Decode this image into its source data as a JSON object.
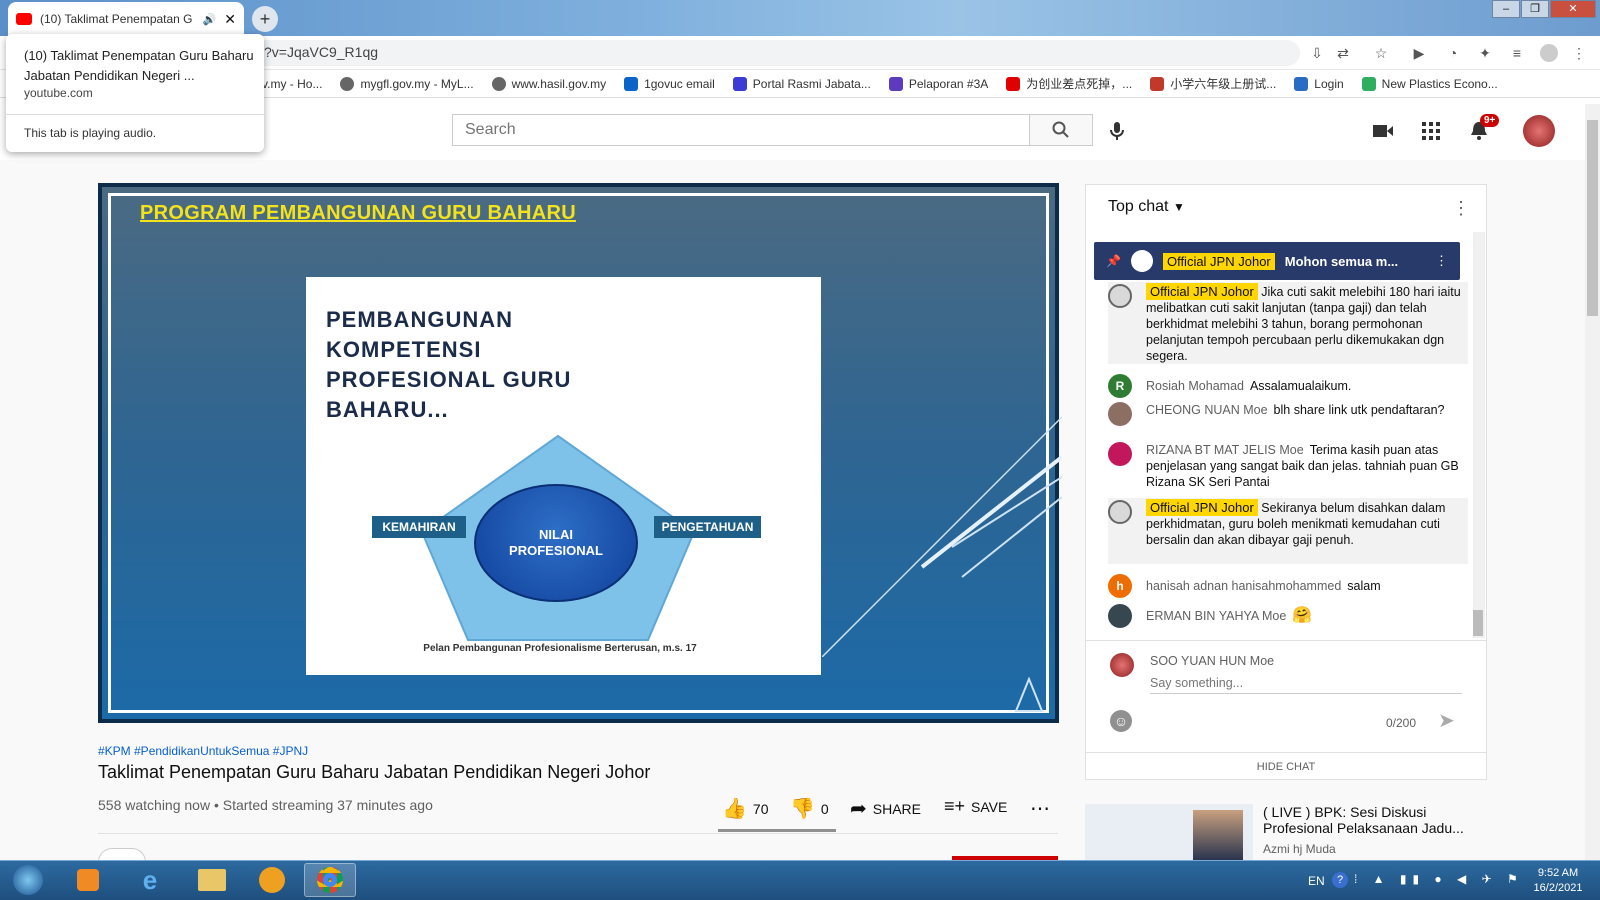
{
  "browser": {
    "tab_title": "(10) Taklimat Penempatan G",
    "url": "?v=JqaVC9_R1qg",
    "tooltip": {
      "title": "(10) Taklimat Penempatan Guru Baharu Jabatan Pendidikan Negeri ...",
      "domain": "youtube.com",
      "audio": "This tab is playing audio."
    },
    "bookmarks": [
      {
        "label": "v.my - Ho...",
        "color": "#888888"
      },
      {
        "label": "mygfl.gov.my - MyL...",
        "color": "#666666"
      },
      {
        "label": "www.hasil.gov.my",
        "color": "#666666"
      },
      {
        "label": "1govuc email",
        "color": "#0a64c8"
      },
      {
        "label": "Portal Rasmi Jabata...",
        "color": "#3b3bd6"
      },
      {
        "label": "Pelaporan #3A",
        "color": "#5c3bbf"
      },
      {
        "label": "为创业差点死掉，...",
        "color": "#e00000"
      },
      {
        "label": "小学六年级上册试...",
        "color": "#c0392b"
      },
      {
        "label": "Login",
        "color": "#2a6cc4"
      },
      {
        "label": "New Plastics Econo...",
        "color": "#2eae5e"
      }
    ]
  },
  "youtube": {
    "search_placeholder": "Search",
    "notif_count": "9+",
    "video": {
      "slide_title": "PROGRAM PEMBANGUNAN GURU BAHARU",
      "slide_heading": "PEMBANGUNAN KOMPETENSI PROFESIONAL GURU BAHARU...",
      "center": "NILAI PROFESIONAL",
      "left_box": "KEMAHIRAN",
      "right_box": "PENGETAHUAN",
      "caption": "Pelan Pembangunan Profesionalisme Berterusan, m.s. 17"
    },
    "tags": "#KPM #PendidikanUntukSemua #JPNJ",
    "title": "Taklimat Penempatan Guru Baharu Jabatan Pendidikan Negeri Johor",
    "views": "558 watching now • Started streaming 37 minutes ago",
    "likes": "70",
    "dislikes": "0",
    "share": "SHARE",
    "save": "SAVE"
  },
  "chat": {
    "header": "Top chat",
    "pinned_badge": "Official JPN Johor",
    "pinned_text": "Mohon semua m...",
    "messages": [
      {
        "author": "Official JPN Johor",
        "badge": true,
        "text": "Jika cuti sakit melebihi 180 hari iaitu melibatkan cuti sakit lanjutan (tanpa gaji) dan telah berkhidmat melebihi 3 tahun, borang permohonan pelanjutan tempoh percubaan perlu dikemukakan dgn segera.",
        "avatar": "#d9d9d9",
        "initial": ""
      },
      {
        "author": "Rosiah Mohamad",
        "badge": false,
        "text": "Assalamualaikum.",
        "avatar": "#2e7d32",
        "initial": "R"
      },
      {
        "author": "CHEONG NUAN Moe",
        "badge": false,
        "text": "blh share link utk pendaftaran?",
        "avatar": "#8d6e63",
        "initial": ""
      },
      {
        "author": "RIZANA BT MAT JELIS Moe",
        "badge": false,
        "text": "Terima kasih puan atas penjelasan yang sangat baik dan jelas. tahniah puan GB Rizana SK Seri Pantai",
        "avatar": "#c2185b",
        "initial": ""
      },
      {
        "author": "Official JPN Johor",
        "badge": true,
        "text": "Sekiranya belum disahkan dalam perkhidmatan, guru boleh menikmati kemudahan cuti bersalin dan akan dibayar gaji penuh.",
        "avatar": "#d9d9d9",
        "initial": ""
      },
      {
        "author": "hanisah adnan hanisahmohammed",
        "badge": false,
        "text": "salam",
        "avatar": "#ef6c00",
        "initial": "h"
      },
      {
        "author": "ERMAN BIN YAHYA Moe",
        "badge": false,
        "text": "🤗",
        "avatar": "#37474f",
        "initial": ""
      }
    ],
    "input_user": "SOO YUAN HUN Moe",
    "input_placeholder": "Say something...",
    "char_count": "0/200",
    "hide": "HIDE CHAT"
  },
  "recommendation": {
    "title": "( LIVE ) BPK: Sesi Diskusi Profesional Pelaksanaan Jadu...",
    "author": "Azmi hj Muda"
  },
  "taskbar": {
    "lang": "EN",
    "time": "9:52 AM",
    "date": "16/2/2021"
  }
}
